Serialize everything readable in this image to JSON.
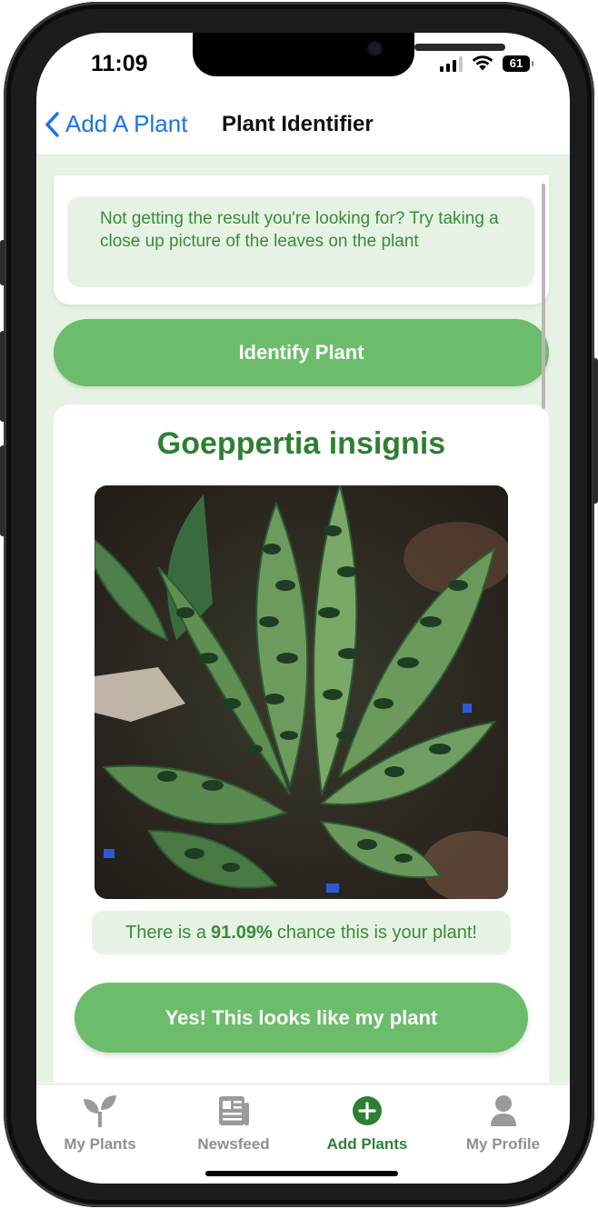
{
  "status_bar": {
    "time": "11:09",
    "battery": "61"
  },
  "nav": {
    "back_label": "Add A Plant",
    "title": "Plant Identifier"
  },
  "tip": {
    "text": "Not getting the result you're looking for? Try taking a close up picture of the leaves on the plant"
  },
  "identify_button": {
    "label": "Identify Plant"
  },
  "result": {
    "plant_name": "Goeppertia insignis",
    "chance_prefix": "There is a",
    "chance_value": "91.09%",
    "chance_suffix": "chance this is your plant!",
    "confirm_label": "Yes! This looks like my plant"
  },
  "tabs": [
    {
      "label": "My Plants",
      "icon": "sprout-icon"
    },
    {
      "label": "Newsfeed",
      "icon": "newspaper-icon"
    },
    {
      "label": "Add Plants",
      "icon": "plus-circle-icon",
      "active": true
    },
    {
      "label": "My Profile",
      "icon": "person-icon"
    }
  ],
  "colors": {
    "brand_green": "#6bbd6b",
    "dark_green": "#2f7f33",
    "light_green_bg": "#e6f3e4",
    "link_blue": "#1a73e8"
  }
}
